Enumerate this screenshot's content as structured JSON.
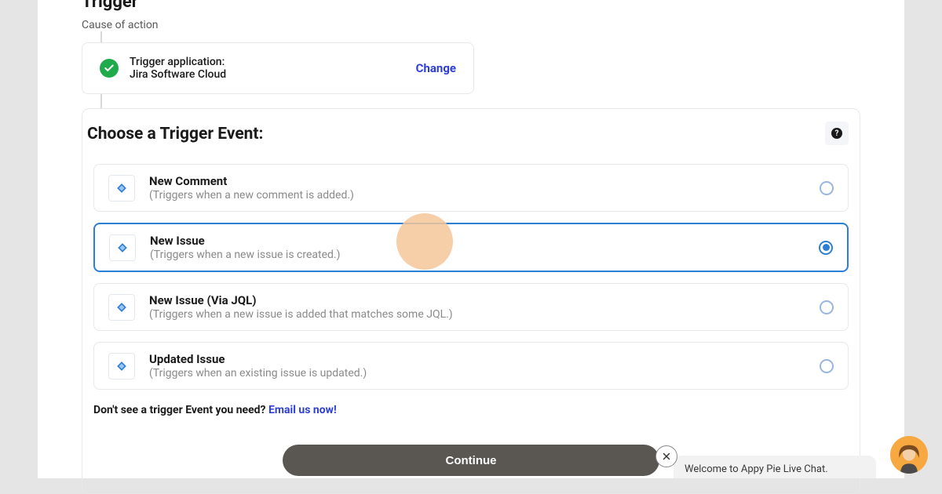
{
  "trigger": {
    "title": "Trigger",
    "subtitle": "Cause of action",
    "app_label": "Trigger application:",
    "app_name": "Jira Software Cloud",
    "change_label": "Change"
  },
  "choose": {
    "title": "Choose a Trigger Event:",
    "options": [
      {
        "title": "New Comment",
        "desc": "(Triggers when a new comment is added.)",
        "selected": false
      },
      {
        "title": "New Issue",
        "desc": "(Triggers when a new issue is created.)",
        "selected": true
      },
      {
        "title": "New Issue (Via JQL)",
        "desc": "(Triggers when a new issue is added that matches some JQL.)",
        "selected": false
      },
      {
        "title": "Updated Issue",
        "desc": "(Triggers when an existing issue is updated.)",
        "selected": false
      }
    ],
    "footer_prefix": "Don't see a trigger Event you need? ",
    "footer_link": "Email us now!",
    "continue_label": "Continue"
  },
  "chat": {
    "message": "Welcome to Appy Pie Live Chat."
  }
}
